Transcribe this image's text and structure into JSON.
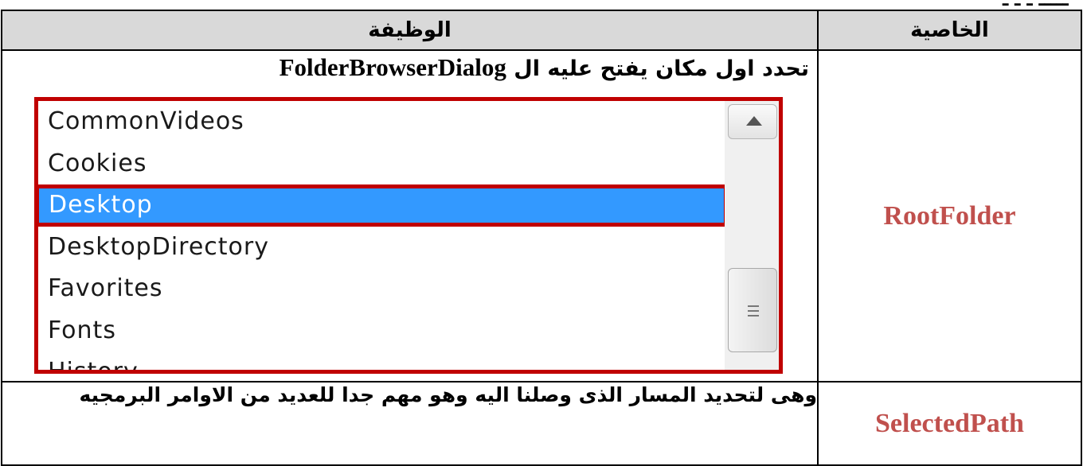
{
  "table": {
    "headers": {
      "function": "الوظيفة",
      "property": "الخاصية"
    },
    "rows": [
      {
        "property": "RootFolder",
        "description_ar": "تحدد اول مكان يفتح عليه ال",
        "description_term": "FolderBrowserDialog",
        "listbox": {
          "items": [
            "CommonVideos",
            "Cookies",
            "Desktop",
            "DesktopDirectory",
            "Favorites",
            "Fonts",
            "History"
          ],
          "selected": "Desktop",
          "highlight_color": "#3399ff",
          "frame_color": "#c00000"
        }
      },
      {
        "property": "SelectedPath",
        "description": "وهى لتحديد المسار الذى وصلنا اليه وهو مهم جدا للعديد من الاوامر البرمجيه"
      }
    ]
  },
  "colors": {
    "property_name": "#c0504d",
    "header_bg": "#d9d9d9"
  }
}
